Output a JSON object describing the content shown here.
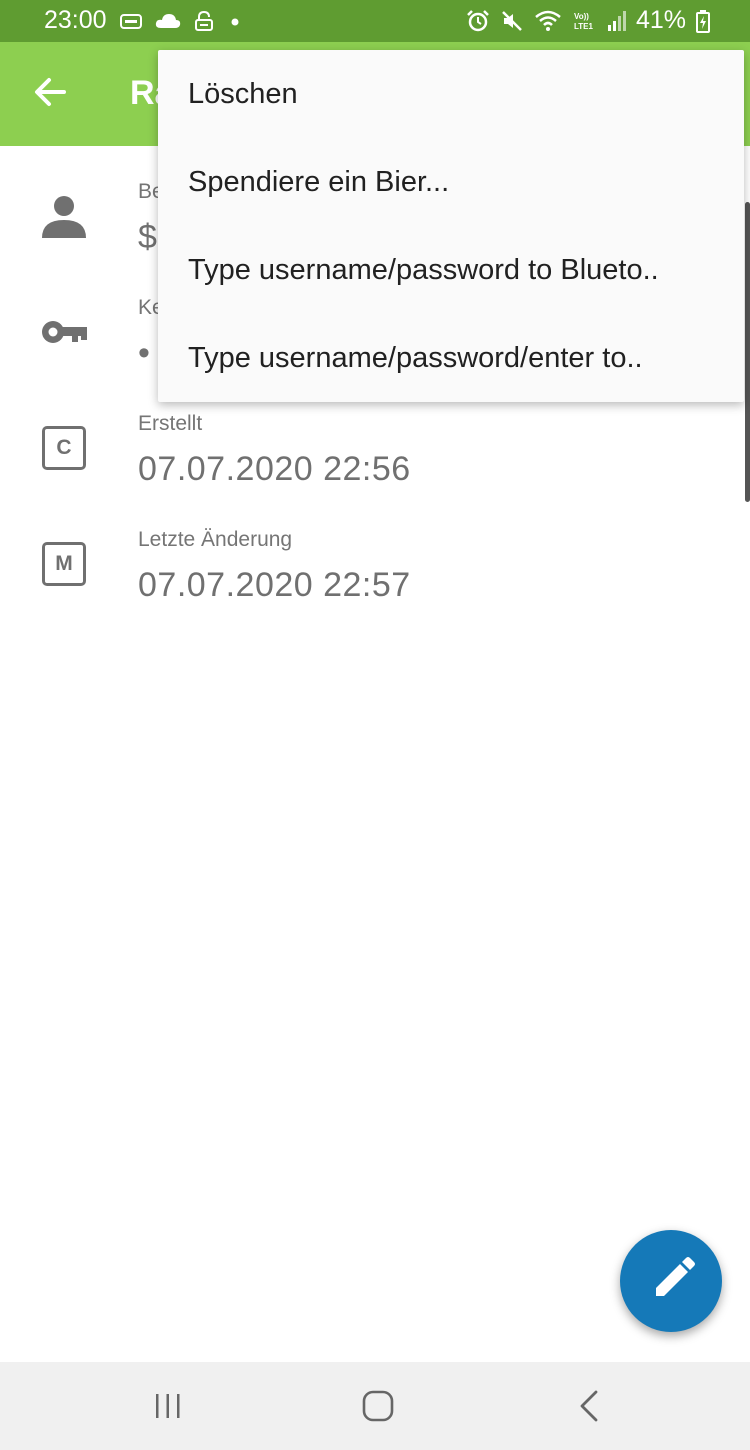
{
  "status_bar": {
    "time": "23:00",
    "battery": "41%",
    "left_icons": [
      "teamviewer-icon",
      "cloud-icon",
      "lock-icon",
      "dot-icon"
    ],
    "right_icons": [
      "alarm-icon",
      "mute-icon",
      "wifi-icon",
      "volte-icon",
      "signal-icon",
      "battery-icon"
    ]
  },
  "app_bar": {
    "title": "Ra",
    "background": "#8dcf50"
  },
  "fields": [
    {
      "label": "Be",
      "value": "$",
      "icon": "person-icon"
    },
    {
      "label": "Ke",
      "value": "•",
      "icon": "key-icon"
    },
    {
      "label": "Erstellt",
      "value": "07.07.2020 22:56",
      "icon": "created-icon",
      "letter": "C"
    },
    {
      "label": "Letzte Änderung",
      "value": "07.07.2020 22:57",
      "icon": "modified-icon",
      "letter": "M"
    }
  ],
  "menu": {
    "items": [
      "Löschen",
      "Spendiere ein Bier...",
      "Type username/password to Blueto..",
      "Type username/password/enter to.."
    ]
  },
  "fab": {
    "icon": "edit-pencil-icon",
    "color": "#1579b8"
  },
  "nav": {
    "icons": [
      "recent-apps-icon",
      "home-icon",
      "back-nav-icon"
    ]
  }
}
